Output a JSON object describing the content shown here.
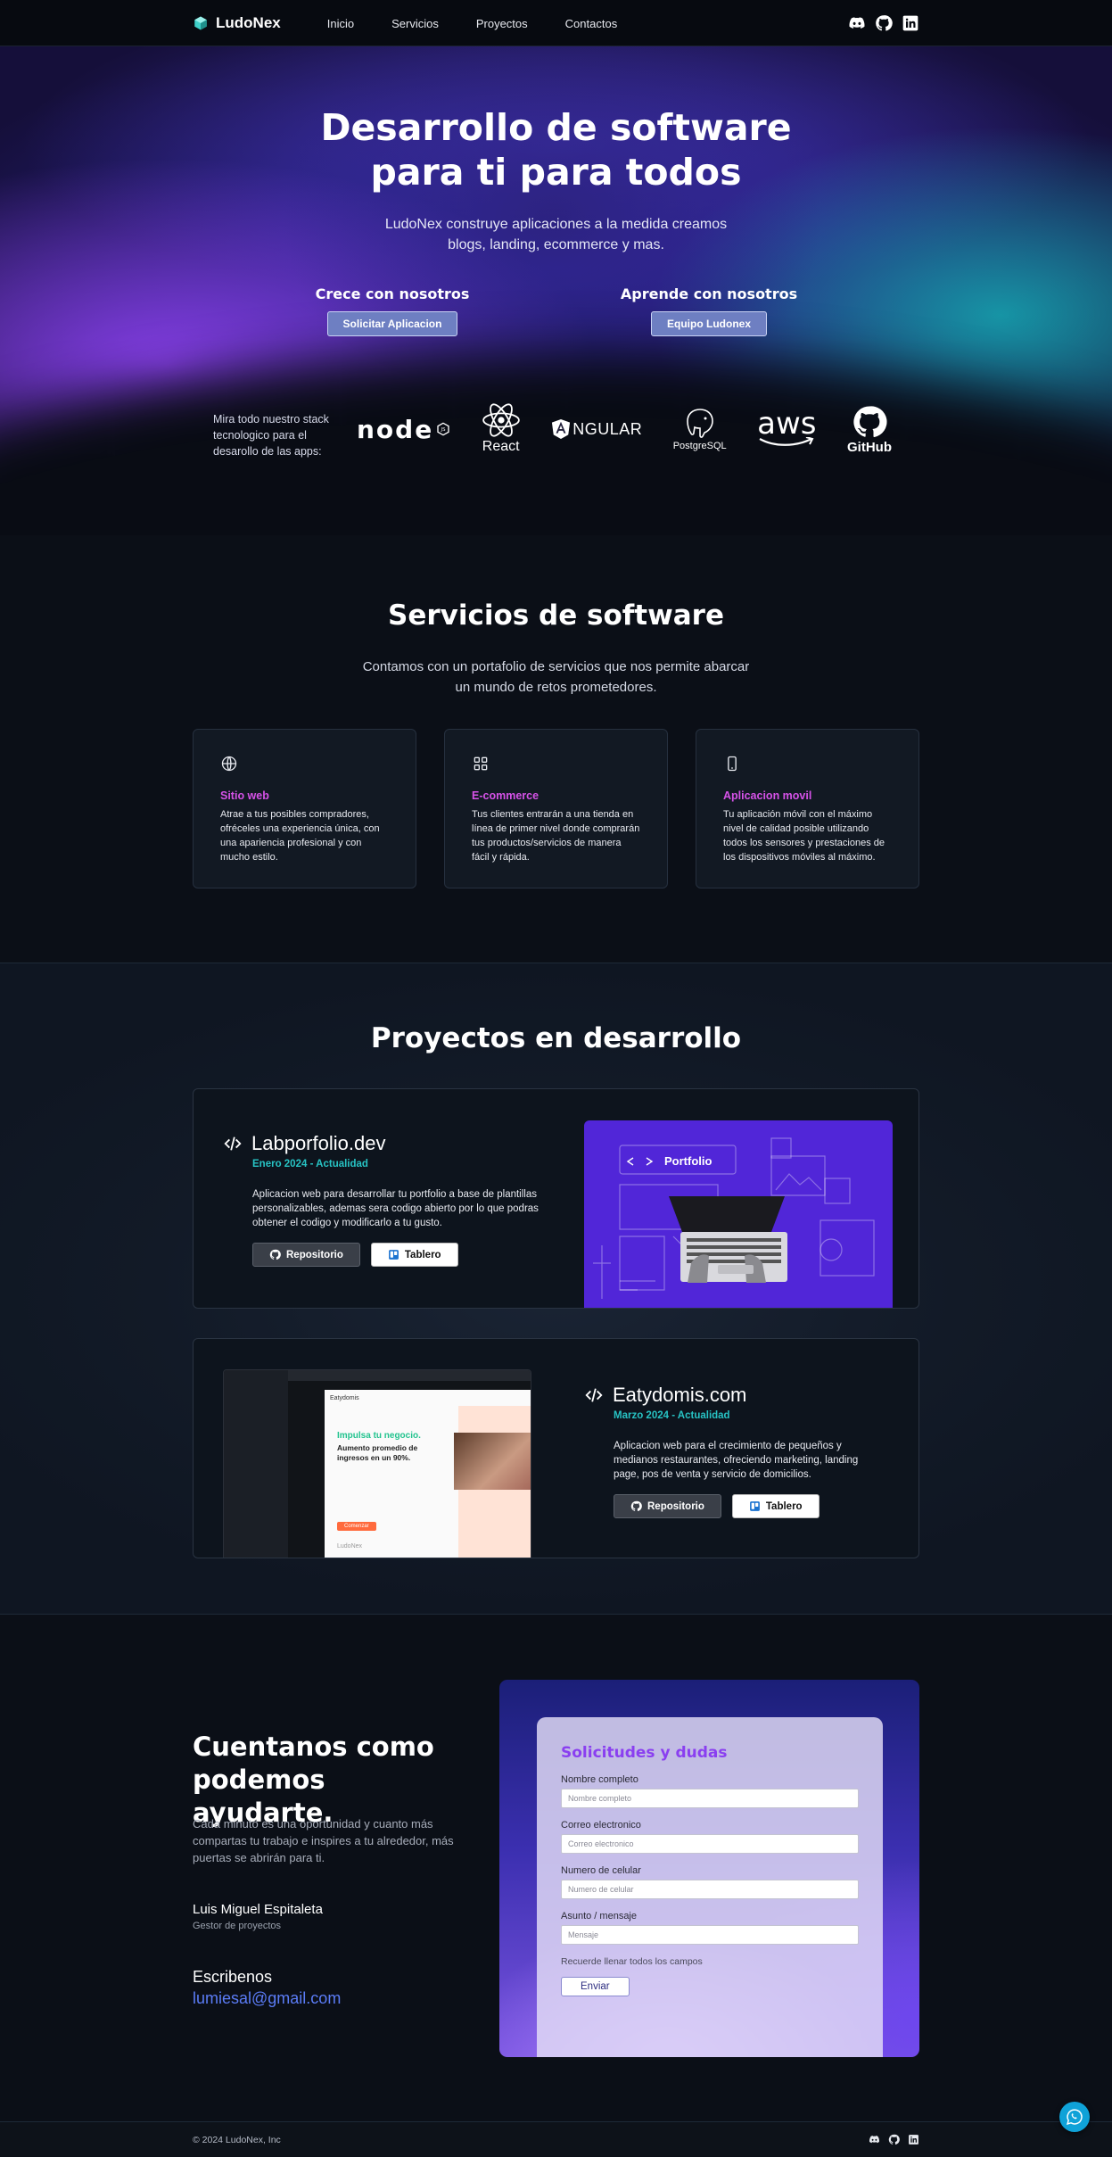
{
  "nav": {
    "brand": "LudoNex",
    "links": [
      "Inicio",
      "Servicios",
      "Proyectos",
      "Contactos"
    ],
    "social_icons": [
      "discord-icon",
      "github-icon",
      "linkedin-icon"
    ]
  },
  "hero": {
    "title": "Desarrollo de software para ti para todos",
    "lead": "LudoNex construye aplicaciones a la medida creamos blogs, landing, ecommerce y mas.",
    "cta_left": {
      "heading": "Crece con nosotros",
      "button": "Solicitar Aplicacion"
    },
    "cta_right": {
      "heading": "Aprende con nosotros",
      "button": "Equipo Ludonex"
    },
    "stack_text": "Mira todo nuestro stack tecnologico para el desarollo de las apps:",
    "stack": {
      "node": "node",
      "react": "React",
      "angular": "NGULAR",
      "postgres": "PostgreSQL",
      "aws": "aws",
      "github": "GitHub"
    }
  },
  "services": {
    "title": "Servicios de software",
    "subtitle": "Contamos con un portafolio de servicios que nos permite abarcar un mundo de retos prometedores.",
    "cards": [
      {
        "icon": "globe-icon",
        "title": "Sitio web",
        "text": "Atrae a tus posibles compradores, ofréceles una experiencia única, con una apariencia profesional y con mucho estilo."
      },
      {
        "icon": "grid-icon",
        "title": "E-commerce",
        "text": "Tus clientes entrarán a una tienda en línea de primer nivel donde comprarán tus productos/servicios de manera fácil y rápida."
      },
      {
        "icon": "mobile-icon",
        "title": "Aplicacion movil",
        "text": "Tu aplicación móvil con el máximo nivel de calidad posible utilizando todos los sensores y prestaciones de los dispositivos móviles al máximo."
      }
    ],
    "accent_color": "#d652e8"
  },
  "projects": {
    "title": "Proyectos en desarrollo",
    "items": [
      {
        "name": "Labporfolio.dev",
        "date": "Enero 2024 - Actualidad",
        "desc": "Aplicacion web para desarrollar tu portfolio a base de plantillas personalizables, ademas sera codigo abierto por lo que podras obtener el codigo y modificarlo a tu gusto.",
        "repo": "Repositorio",
        "board": "Tablero",
        "image_label": "Portfolio"
      },
      {
        "name": "Eatydomis.com",
        "date": "Marzo 2024 - Actualidad",
        "desc": "Aplicacion web para el crecimiento de pequeños y medianos restaurantes, ofreciendo marketing, landing page, pos de venta y servicio de domicilios.",
        "repo": "Repositorio",
        "board": "Tablero",
        "image_label": "Impulsa tu negocio.",
        "image_sub": "Aumento promedio de ingresos en un 90%.",
        "image_brand": "Eatydomis",
        "image_button": "Comenzar",
        "image_footer": "LudoNex"
      }
    ],
    "date_color": "#27c3c4"
  },
  "contact": {
    "title": "Cuentanos como podemos ayudarte.",
    "desc": "Cada minuto es una oportunidad y cuanto más compartas tu trabajo e inspires a tu alrededor, más puertas se abrirán para ti.",
    "person_name": "Luis Miguel Espitaleta",
    "person_role": "Gestor de proyectos",
    "write_label": "Escribenos",
    "email": "lumiesal@gmail.com",
    "form": {
      "title": "Solicitudes y dudas",
      "fields": [
        {
          "label": "Nombre completo",
          "placeholder": "Nombre completo"
        },
        {
          "label": "Correo electronico",
          "placeholder": "Correo electronico"
        },
        {
          "label": "Numero de celular",
          "placeholder": "Numero de celular"
        },
        {
          "label": "Asunto / mensaje",
          "placeholder": "Mensaje"
        }
      ],
      "hint": "Recuerde llenar todos los campos",
      "submit": "Enviar"
    }
  },
  "footer": {
    "copyright": "© 2024 LudoNex, Inc"
  }
}
